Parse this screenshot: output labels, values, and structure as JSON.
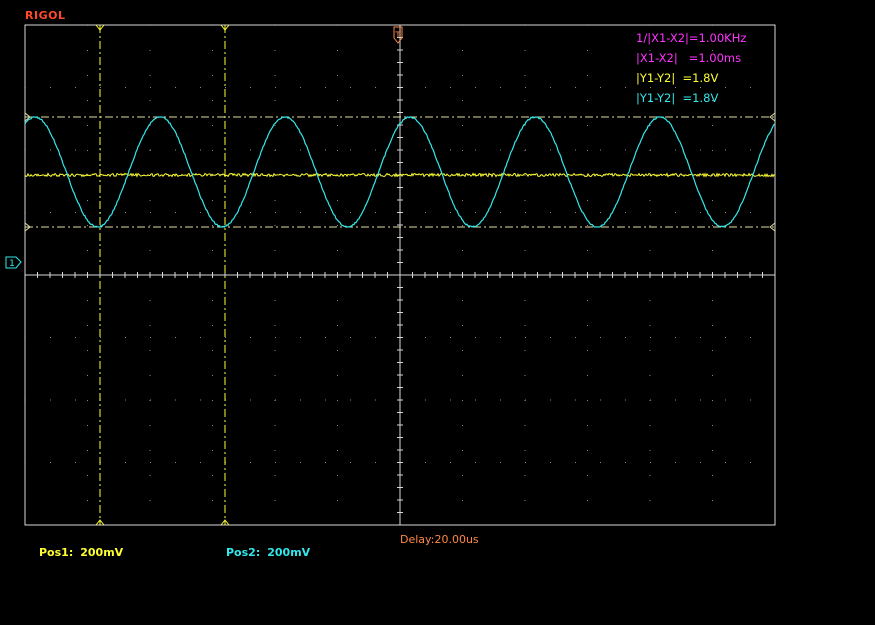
{
  "brand": "RIGOL",
  "colors": {
    "brand": "#ff4a2a",
    "grid": "#d8d8d8",
    "ch1": "#ffff33",
    "ch2": "#33e8ec",
    "math_cursor": "#ff33ff",
    "trigger_marker": "#ff8844",
    "delay": "#ff8844"
  },
  "measurements": [
    {
      "text": "1/|X1-X2|=1.00KHz",
      "color": "#ff33ff"
    },
    {
      "text": "|X1-X2|   =1.00ms",
      "color": "#ff33ff"
    },
    {
      "text": "|Y1-Y2|  =1.8V",
      "color": "#ffff33"
    },
    {
      "text": "|Y1-Y2|  =1.8V",
      "color": "#33e8ec"
    }
  ],
  "trigger_marker_label": "T",
  "channel_marker_label": "1",
  "status": {
    "pos1_label": "Pos1:",
    "pos1_value": "200mV",
    "pos2_label": "Pos2:",
    "pos2_value": "200mV",
    "delay": "Delay:20.00us"
  },
  "waveforms": {
    "ch2": {
      "type": "sine",
      "frequency_hz": 1000,
      "cycles_visible": 6
    },
    "ch1": {
      "type": "flat-noise"
    }
  }
}
